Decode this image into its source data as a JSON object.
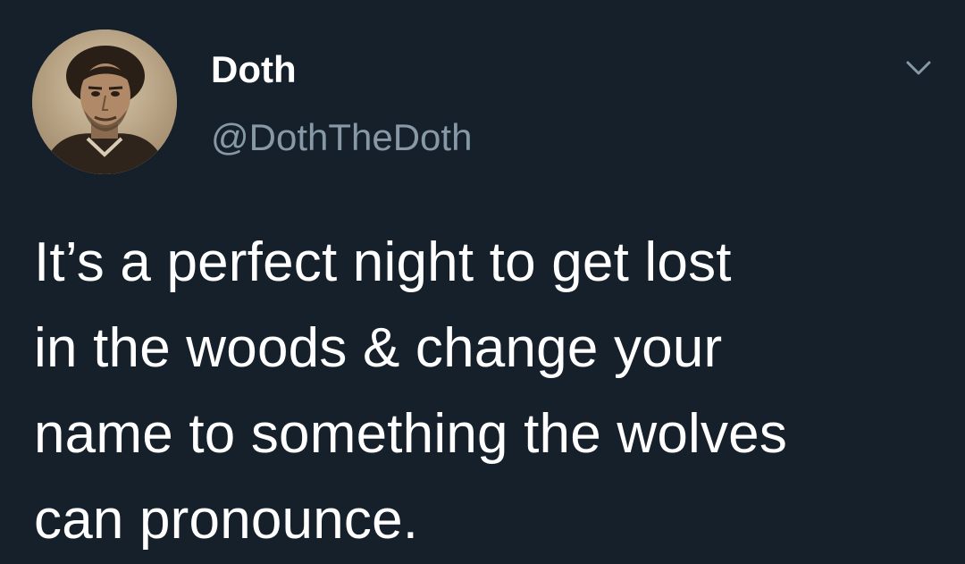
{
  "tweet": {
    "author": {
      "display_name": "Doth",
      "handle": "@DothTheDoth",
      "avatar_icon": "portrait-avatar"
    },
    "menu_icon": "chevron-down-icon",
    "text": "It’s a perfect night to get lost\nin the woods & change your\nname to something the wolves\ncan pronounce."
  },
  "colors": {
    "background": "#15202b",
    "text_primary": "#ffffff",
    "text_secondary": "#8899a6"
  }
}
